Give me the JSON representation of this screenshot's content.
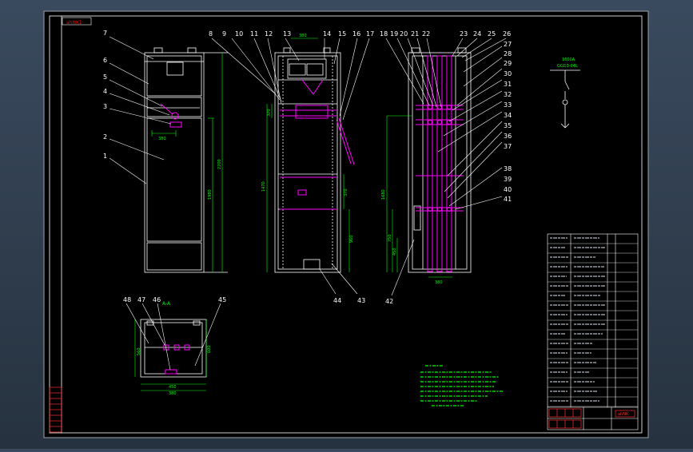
{
  "viewer": {
    "background_color": "#2e3c4f",
    "sheet_color": "#000000",
    "line_color": "#ffffff",
    "dimension_color": "#00ff00",
    "highlight_color": "#ff00ff",
    "label_color": "#00ff00",
    "stamp_color": "#ff0000"
  },
  "drawing": {
    "title_stamp_top": "ahNK1",
    "section_label": "A-A",
    "part_numbers_top": [
      "7",
      "6",
      "5",
      "4",
      "3",
      "2",
      "1",
      "8",
      "9",
      "10",
      "11",
      "12",
      "13",
      "14",
      "15",
      "16",
      "17",
      "18",
      "19",
      "20",
      "21",
      "22",
      "23",
      "24",
      "25",
      "26"
    ],
    "part_numbers_right": [
      "27",
      "28",
      "29",
      "30",
      "31",
      "32",
      "33",
      "34",
      "35",
      "36",
      "37",
      "38",
      "39",
      "40",
      "41"
    ],
    "part_numbers_bottom": [
      "44",
      "43",
      "42"
    ],
    "part_numbers_plan": [
      "48",
      "47",
      "46",
      "45"
    ],
    "dims_front": [
      "380",
      "2200",
      "1980",
      "2"
    ],
    "dims_mid": [
      "1470",
      "370",
      "960",
      "380"
    ],
    "dims_side": [
      "1680",
      "750",
      "450",
      "480"
    ],
    "dims_plan": [
      "450",
      "560",
      "600",
      "380"
    ],
    "bottom_dim_side": "380",
    "schematic_title": "1600A",
    "schematic_subtitle": "GGD3-04L",
    "stamp_bottom_right": "ahNK"
  }
}
